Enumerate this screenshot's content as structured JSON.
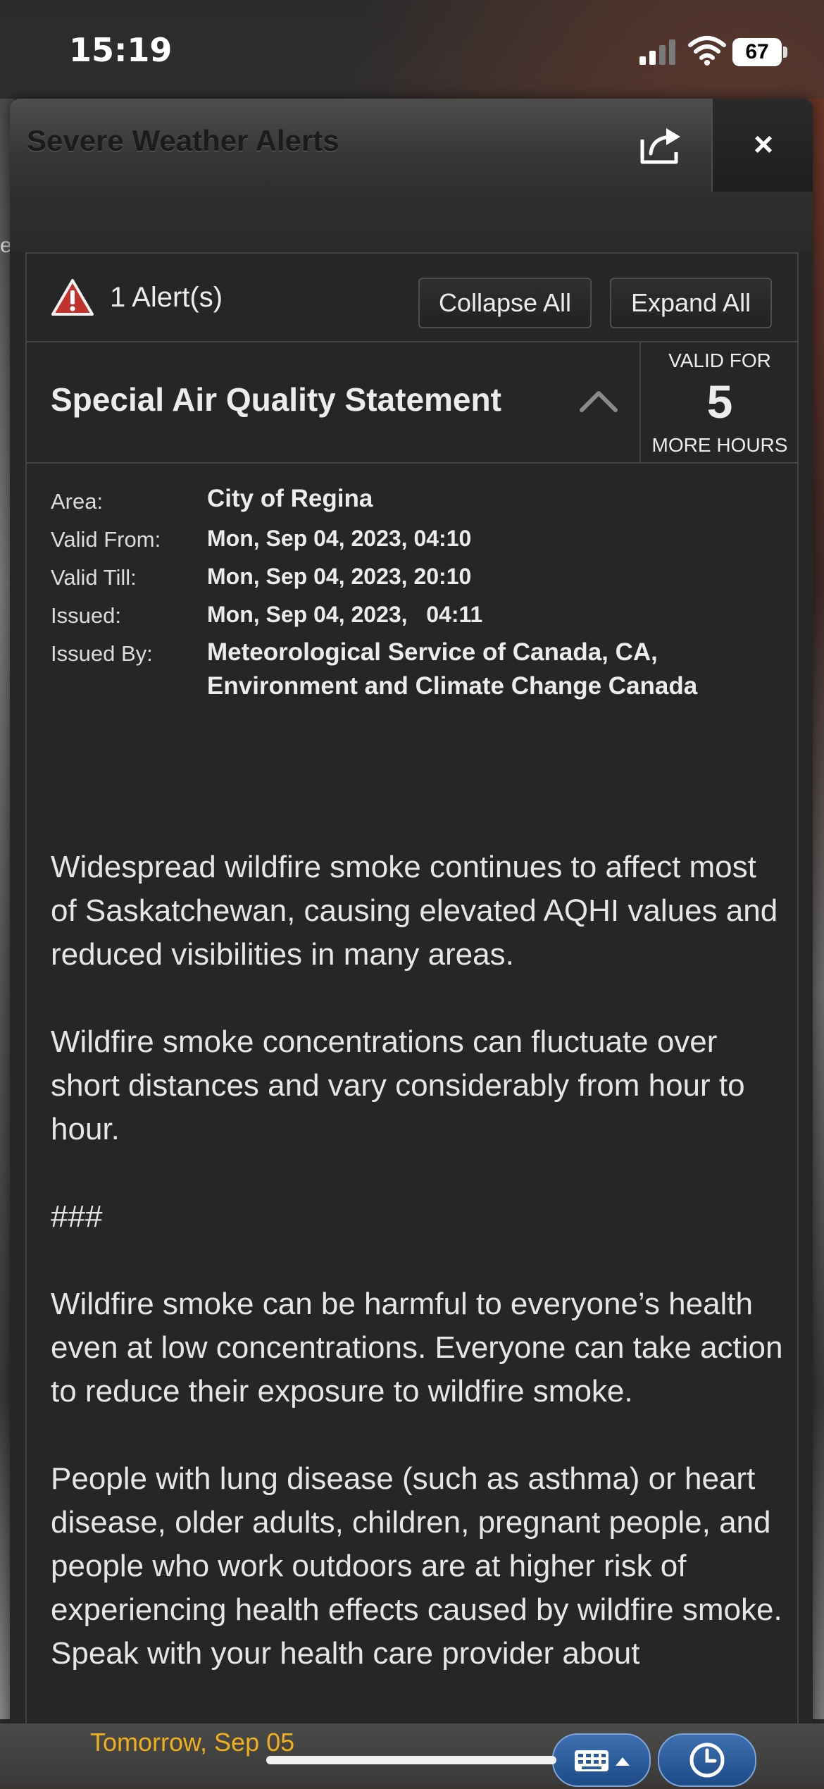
{
  "status_bar": {
    "time": "15:19",
    "battery": "67"
  },
  "background": {
    "edge_letter": "e"
  },
  "panel": {
    "title": "Severe Weather Alerts",
    "close_label": "×"
  },
  "alerts_bar": {
    "count_label": "1 Alert(s)",
    "collapse_label": "Collapse All",
    "expand_label": "Expand All"
  },
  "alert": {
    "title": "Special Air Quality Statement",
    "valid_for_top": "VALID FOR",
    "valid_for_hours": "5",
    "valid_for_bottom": "MORE HOURS",
    "details": [
      {
        "label": "Area:",
        "value": "City of Regina"
      },
      {
        "label": "Valid From:",
        "value": "Mon, Sep 04, 2023, 04:10"
      },
      {
        "label": "Valid Till:",
        "value": "Mon, Sep 04, 2023, 20:10"
      },
      {
        "label": "Issued:",
        "value": "Mon, Sep 04, 2023,   04:11"
      },
      {
        "label": "Issued By:",
        "value": "Meteorological Service of Canada, CA,\nEnvironment and Climate Change Canada"
      }
    ],
    "paragraphs": [
      "Widespread wildfire smoke continues to affect most of Saskatchewan, causing elevated AQHI values and reduced visibilities in many areas.",
      "Wildfire smoke concentrations can fluctuate over short distances and vary considerably from hour to hour.",
      "###",
      "Wildfire smoke can be harmful to everyone’s health even at low concentrations. Everyone can take action to reduce their exposure to wildfire smoke.",
      "People with lung disease (such as asthma) or heart disease, older adults, children, pregnant people, and people who work outdoors are at higher risk of experiencing health effects caused by wildfire smoke. Speak with your health care provider about"
    ]
  },
  "bottom_bar": {
    "day_label": "Tomorrow, Sep 05"
  },
  "colors": {
    "accent_day": "#f0b01a",
    "alert_red": "#c0322e",
    "button_blue": "#2a5a9a"
  }
}
